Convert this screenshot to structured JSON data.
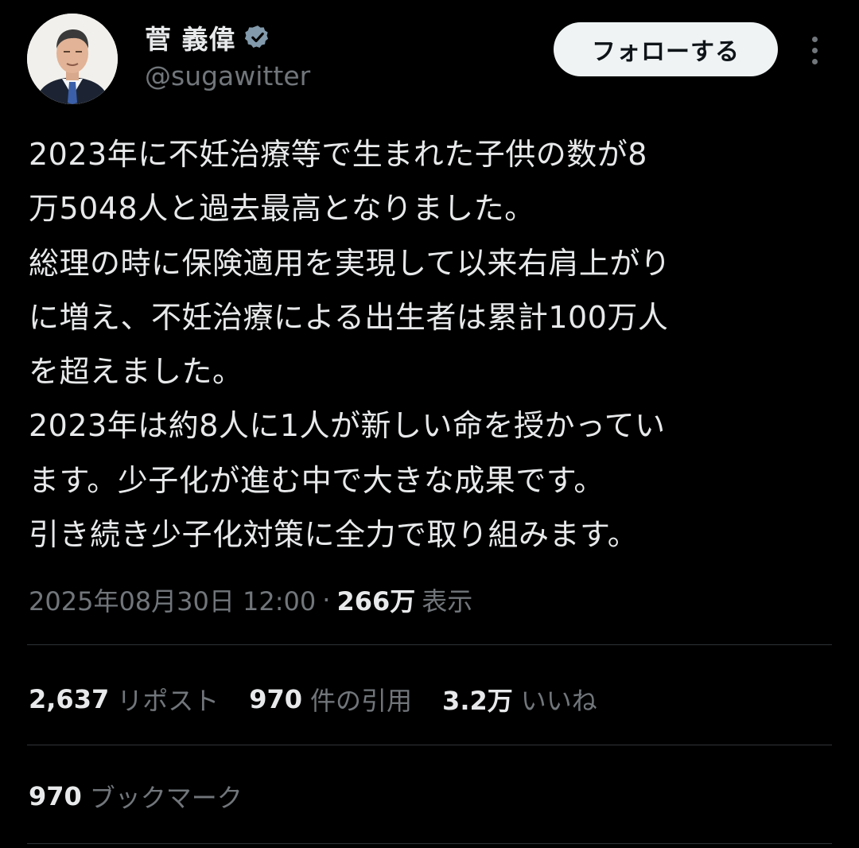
{
  "author": {
    "display_name": "菅 義偉",
    "handle": "@sugawitter",
    "verified": true,
    "avatar_icon": "profile-photo"
  },
  "actions": {
    "follow_label": "フォローする",
    "more_icon": "more-dots-icon"
  },
  "tweet": {
    "lines": [
      "2023年に不妊治療等で生まれた子供の数が8",
      "万5048人と過去最高となりました。",
      "総理の時に保険適用を実現して以来右肩上がり",
      "に増え、不妊治療による出生者は累計100万人",
      "を超えました。",
      "2023年は約8人に1人が新しい命を授かってい",
      "ます。少子化が進む中で大きな成果です。",
      "引き続き少子化対策に全力で取り組みます。"
    ]
  },
  "meta": {
    "timestamp": "2025年08月30日 12:00",
    "separator": "·",
    "views_count": "266万",
    "views_label": "表示"
  },
  "stats": {
    "reposts": {
      "count": "2,637",
      "label": "リポスト"
    },
    "quotes": {
      "count": "970",
      "label": "件の引用"
    },
    "likes": {
      "count": "3.2万",
      "label": "いいね"
    },
    "bookmarks": {
      "count": "970",
      "label": "ブックマーク"
    }
  },
  "colors": {
    "background": "#000000",
    "primary_text": "#e7e9ea",
    "secondary_text": "#71767b",
    "divider": "#2f3336",
    "follow_button_bg": "#eff3f4",
    "verified_badge": "#829aab"
  }
}
